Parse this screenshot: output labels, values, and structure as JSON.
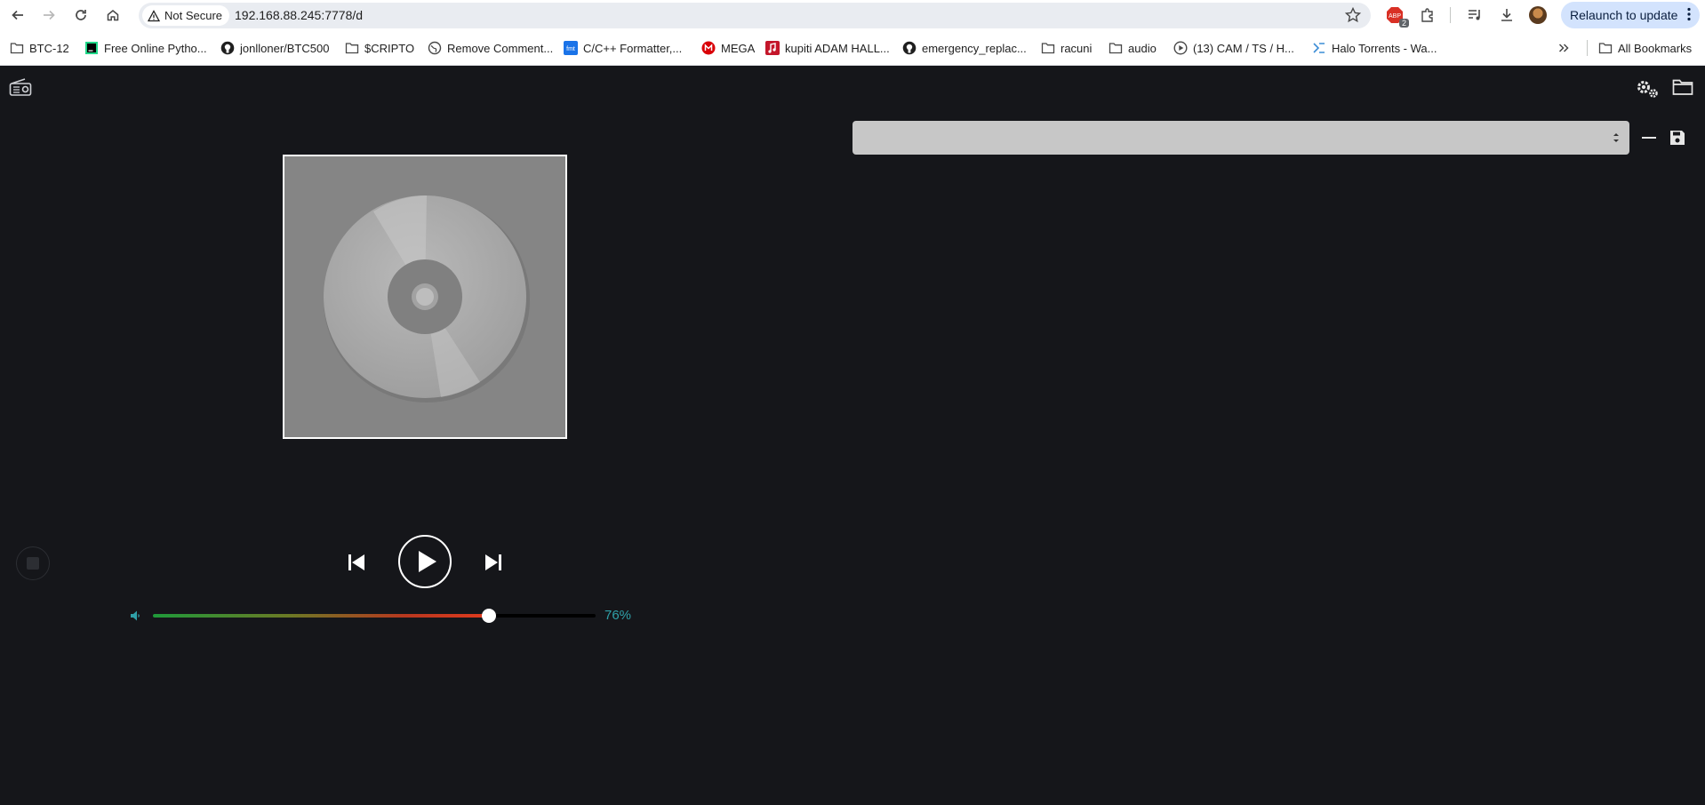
{
  "browser": {
    "security_label": "Not Secure",
    "url": "192.168.88.245:7778/d",
    "extension_badge": "2",
    "relaunch_label": "Relaunch to update"
  },
  "bookmarks": [
    {
      "label": "BTC-12",
      "icon": "folder-icon"
    },
    {
      "label": "Free Online Pytho...",
      "icon": "pycharm-icon"
    },
    {
      "label": "jonlloner/BTC500",
      "icon": "github-icon"
    },
    {
      "label": "$CRIPTO",
      "icon": "folder-icon"
    },
    {
      "label": "Remove Comment...",
      "icon": "globe-icon"
    },
    {
      "label": "C/C++ Formatter,...",
      "icon": "fmt-icon"
    },
    {
      "label": "MEGA",
      "icon": "mega-icon"
    },
    {
      "label": "kupiti ADAM HALL...",
      "icon": "music-icon"
    },
    {
      "label": "emergency_replac...",
      "icon": "github-icon"
    },
    {
      "label": "racuni",
      "icon": "folder-icon"
    },
    {
      "label": "audio",
      "icon": "folder-icon"
    },
    {
      "label": "(13) CAM / TS / H...",
      "icon": "play-circle-icon"
    },
    {
      "label": "Halo Torrents - Wa...",
      "icon": "halo-icon"
    }
  ],
  "all_bookmarks_label": "All Bookmarks",
  "player": {
    "volume_percent": 76,
    "volume_label": "76%",
    "colors": {
      "accent": "#2fa0a8",
      "background": "#15161a"
    }
  },
  "playlist_select": {
    "value": ""
  }
}
